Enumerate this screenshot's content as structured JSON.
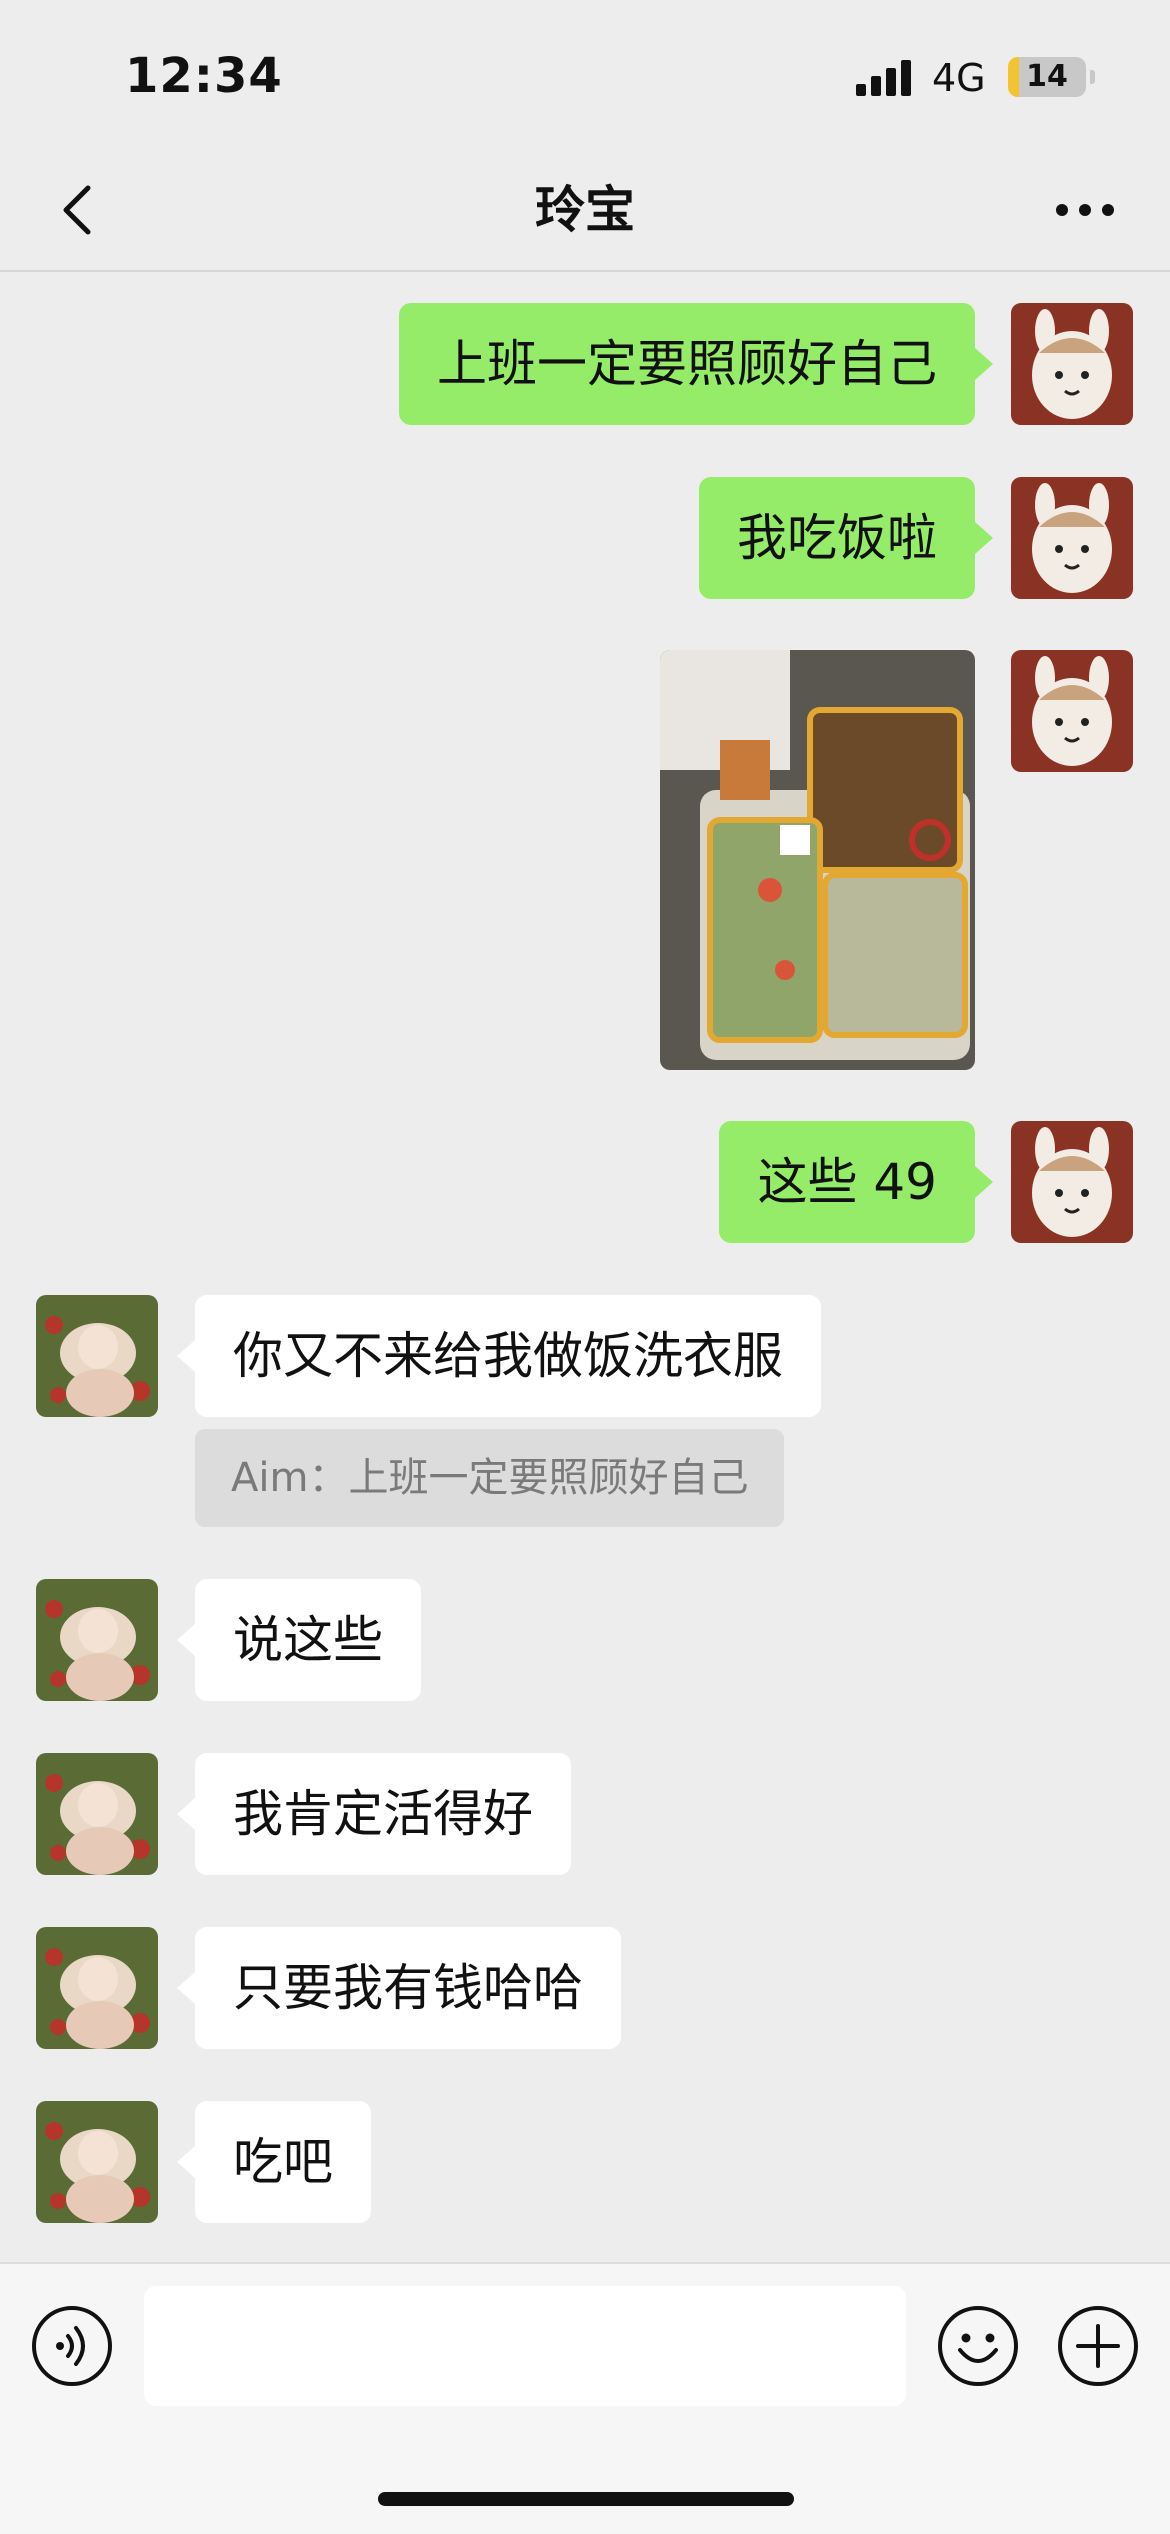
{
  "status_bar": {
    "time": "12:34",
    "network": "4G",
    "battery": "14",
    "battery_level": 0.14
  },
  "header": {
    "title": "玲宝"
  },
  "messages": {
    "m1": {
      "text": "上班一定要照顾好自己"
    },
    "m2": {
      "text": "我吃饭啦"
    },
    "m3": {
      "type": "image",
      "description_icon": "food-photo"
    },
    "m4": {
      "text": "这些 49"
    },
    "m5": {
      "text": "你又不来给我做饭洗衣服",
      "quote": "Aim：上班一定要照顾好自己"
    },
    "m6": {
      "text": "说这些"
    },
    "m7": {
      "text": "我肯定活得好"
    },
    "m8": {
      "text": "只要我有钱哈哈"
    },
    "m9": {
      "text": "吃吧"
    }
  },
  "input": {
    "value": "",
    "placeholder": ""
  },
  "colors": {
    "my_bubble": "#95ec69",
    "other_bubble": "#ffffff",
    "background": "#ededed",
    "battery": "#f4c430"
  }
}
